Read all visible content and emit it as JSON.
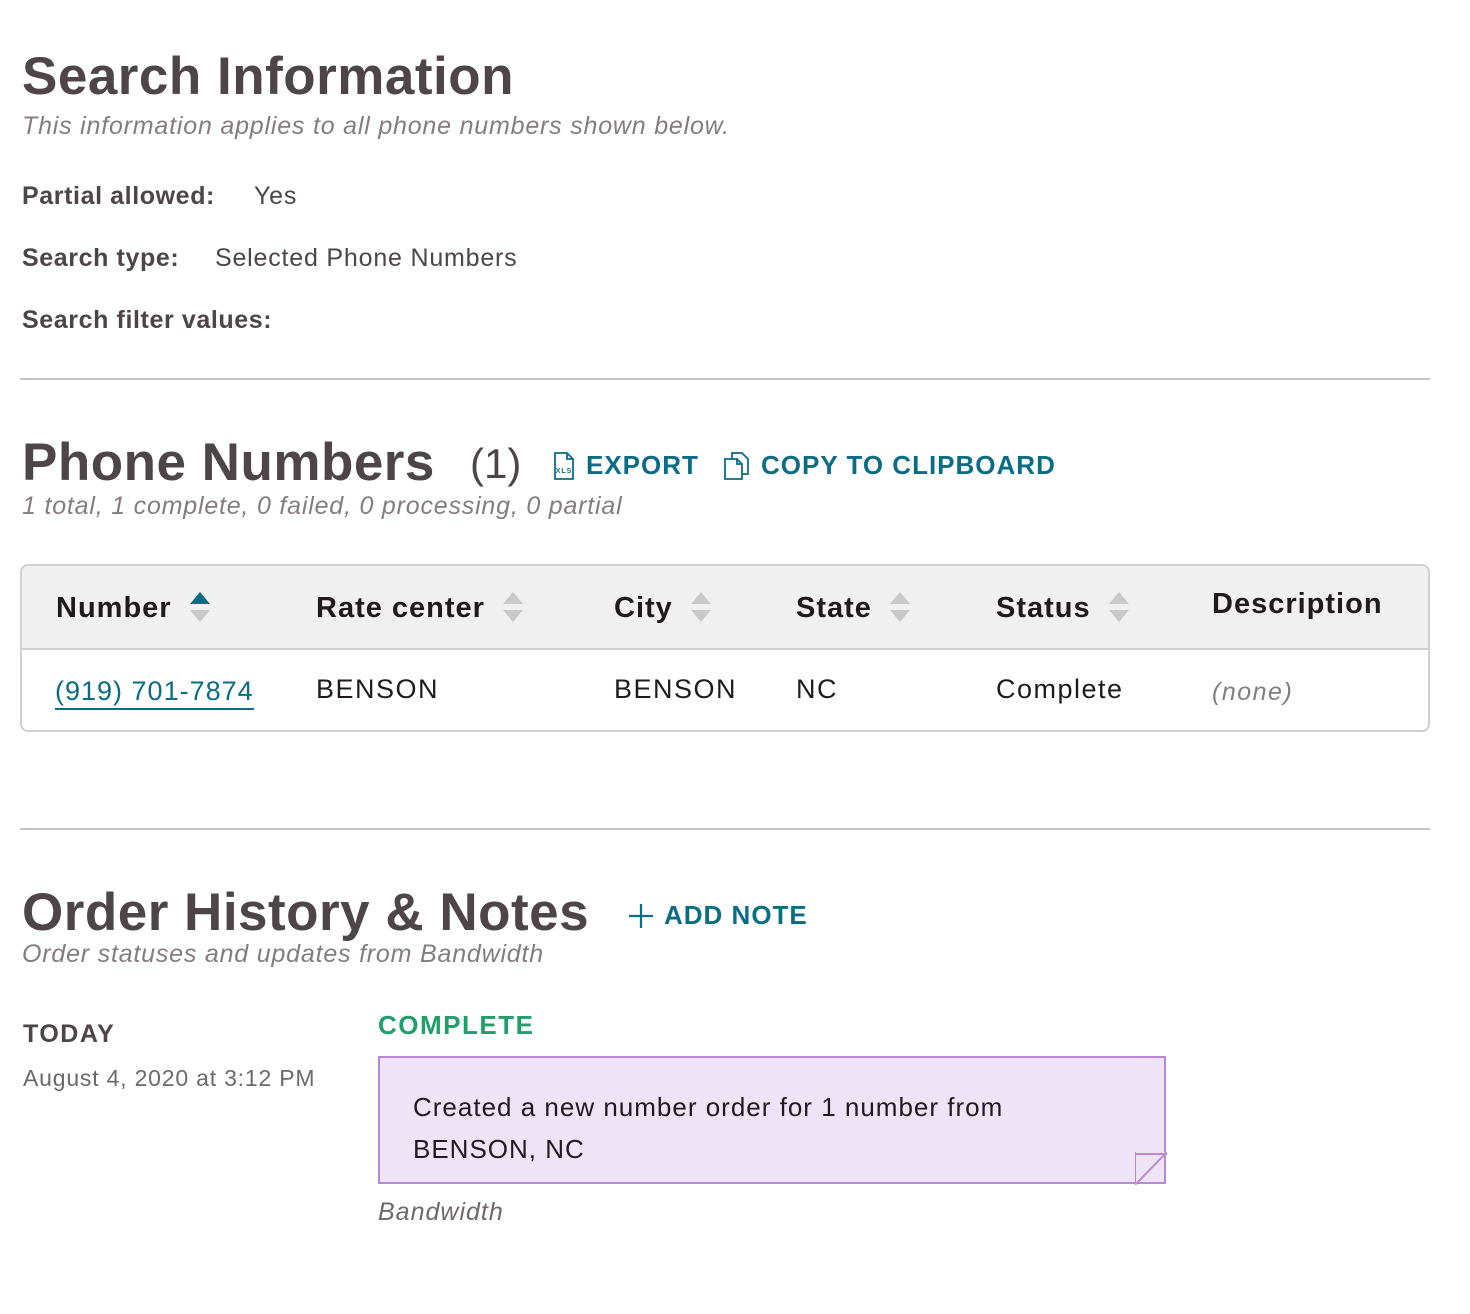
{
  "search_info": {
    "title": "Search Information",
    "subtitle": "This information applies to all phone numbers shown below.",
    "rows": [
      {
        "label": "Partial allowed:",
        "value": "Yes"
      },
      {
        "label": "Search type:",
        "value": "Selected Phone Numbers"
      },
      {
        "label": "Search filter values:",
        "value": ""
      }
    ]
  },
  "phone_numbers": {
    "title": "Phone Numbers",
    "count": "(1)",
    "export_label": "EXPORT",
    "copy_label": "COPY TO CLIPBOARD",
    "summary": "1 total, 1 complete, 0 failed, 0 processing, 0 partial",
    "columns": [
      "Number",
      "Rate center",
      "City",
      "State",
      "Status",
      "Description"
    ],
    "sort_column": "Number",
    "sort_direction": "ascending",
    "rows": [
      {
        "number": "(919) 701-7874",
        "rate_center": "BENSON",
        "city": "BENSON",
        "state": "NC",
        "status": "Complete",
        "description": "(none)"
      }
    ]
  },
  "order_history": {
    "title": "Order History & Notes",
    "add_note_label": "ADD NOTE",
    "subtitle": "Order statuses and updates from Bandwidth",
    "entries": [
      {
        "day": "TODAY",
        "date": "August 4, 2020 at 3:12 PM",
        "status": "COMPLETE",
        "note": "Created a new number order for 1 number from BENSON, NC",
        "author": "Bandwidth"
      }
    ]
  },
  "colors": {
    "accent": "#0a6d86",
    "status_complete": "#1fa06a",
    "note_background": "#efe3f7",
    "note_border": "#b887d6"
  }
}
